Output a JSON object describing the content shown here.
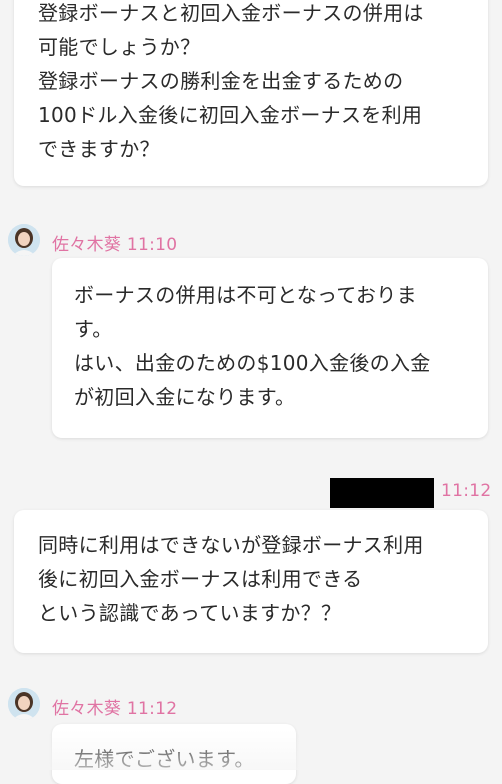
{
  "conversation": {
    "messages": [
      {
        "type": "outgoing",
        "lines": [
          "登録ボーナスと初回入金ボーナスの併用は",
          "可能でしょうか？",
          "登録ボーナスの勝利金を出金するための",
          "100ドル入金後に初回入金ボーナスを利用",
          "できますか？"
        ]
      },
      {
        "type": "incoming",
        "sender": "佐々木葵",
        "time": "11:10",
        "lines": [
          "ボーナスの併用は不可となっておりま",
          "す。",
          "はい、出金のための$100入金後の入金",
          "が初回入金になります。"
        ]
      },
      {
        "type": "outgoing",
        "time": "11:12",
        "lines": [
          "同時に利用はできないが登録ボーナス利用",
          "後に初回入金ボーナスは利用できる",
          "という認識であっていますか？？"
        ]
      },
      {
        "type": "incoming",
        "sender": "佐々木葵",
        "time": "11:12",
        "lines": [
          "左様でございます。"
        ]
      }
    ]
  },
  "colors": {
    "accent": "#e073a3",
    "background": "#f4f4f4",
    "bubble": "#ffffff",
    "text": "#2a2a2a"
  }
}
